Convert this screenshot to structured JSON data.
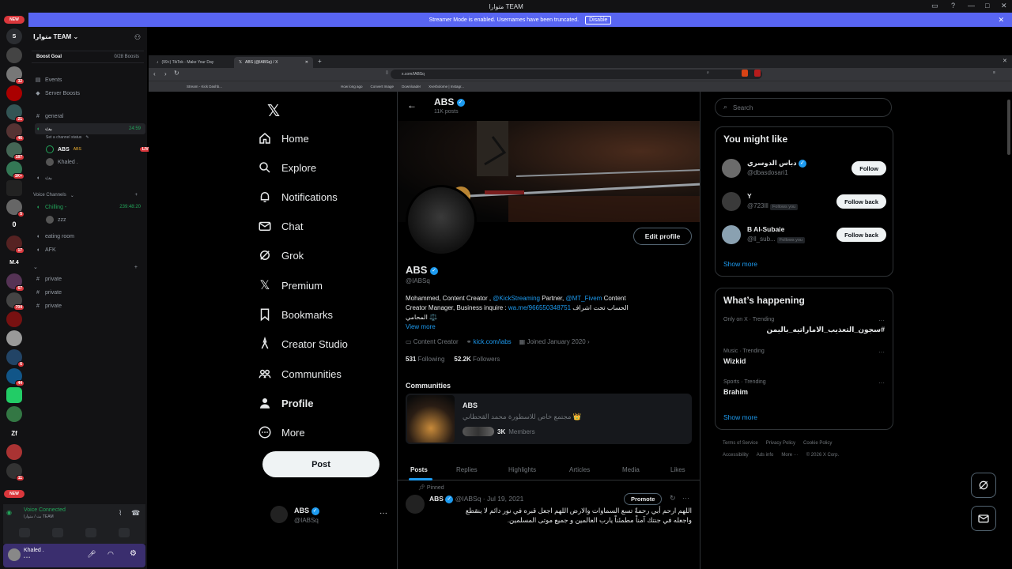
{
  "window": {
    "title": "متوارا TEAM"
  },
  "streamer_banner": {
    "text": "Streamer Mode is enabled. Usernames have been truncated.",
    "button": "Disable"
  },
  "rail": {
    "new_label": "NEW",
    "letter_s": "S",
    "badges": [
      "32",
      "21",
      "46",
      "187",
      "1K+",
      "5",
      "17",
      "67",
      "704",
      "6",
      "44",
      "11"
    ],
    "zero": "0",
    "m4": "M.4",
    "zf": "Zf",
    "new_label_bottom": "NEW"
  },
  "discord": {
    "server_name": "متوارا TEAM",
    "boost_goal": "Boost Goal",
    "boost_count": "0/28 Boosts",
    "events": "Events",
    "server_boosts": "Server Boosts",
    "ch_general": "general",
    "ch_live": "بث",
    "ch_live_time": "24:59",
    "ch_status": "Set a channel status",
    "user_abs": "ABS",
    "user_abs_tag": "ABS",
    "live_badge": "LIVE",
    "user_khaled": "Khaled .",
    "ch_voice2": "بث",
    "voice_channels": "Voice Channels",
    "ch_chilling": "Chilling -",
    "ch_chilling_time": "239:48:20",
    "user_zzz": "zzz",
    "ch_eating": "eating room",
    "ch_afk": "AFK",
    "ch_private": [
      "private",
      "private",
      "private"
    ],
    "voice_connected": "Voice Connected",
    "voice_sub": "بث / متوارا TEAM",
    "me_name": "Khaled .",
    "me_status": "• • •"
  },
  "browser": {
    "tabs": [
      {
        "label": "(99+) TikTok - Make Your Day"
      },
      {
        "label": "ABS (@IABSq) / X"
      }
    ],
    "url": "x.com/IABSq",
    "bookmarks": [
      "Stream - Kick Dashb...",
      "How long ago",
      "Convert Image",
      "Downloader",
      "Xverbolome | Instagr..."
    ]
  },
  "x": {
    "nav": [
      "Home",
      "Explore",
      "Notifications",
      "Chat",
      "Grok",
      "Premium",
      "Bookmarks",
      "Creator Studio",
      "Communities",
      "Profile",
      "More"
    ],
    "post_button": "Post",
    "account_name": "ABS",
    "account_handle": "@IABSq",
    "header_name": "ABS",
    "header_posts": "11K posts",
    "edit_profile": "Edit profile",
    "profile_name": "ABS",
    "profile_handle": "@IABSq",
    "bio_1a": "Mohammed, Content Creator , ",
    "bio_link1": "@KickStreaming",
    "bio_1b": " Partner, ",
    "bio_link2": "@MT_Fivem",
    "bio_1c": " Content",
    "bio_2a": "Creator Manager, Business inquire : ",
    "bio_link3": "wa.me/966550348751",
    "bio_2b": " الحساب تحت اشراف",
    "bio_3": "المحامي ⚖️",
    "view_more": "View more",
    "category": "Content Creator",
    "website": "kick.com/iabs",
    "joined": "Joined January 2020",
    "following_count": "531",
    "following_label": "Following",
    "followers_count": "52.2K",
    "followers_label": "Followers",
    "communities_heading": "Communities",
    "community_name": "ABS",
    "community_desc": "مجتمع خاص للاسطورة محمد القحطاني 👑",
    "community_members_count": "3K",
    "community_members_label": "Members",
    "profile_tabs": [
      "Posts",
      "Replies",
      "Highlights",
      "Articles",
      "Media",
      "Likes"
    ],
    "pinned_label": "Pinned",
    "tweet_name": "ABS",
    "tweet_meta": "@IABSq · Jul 19, 2021",
    "promote": "Promote",
    "tweet_line1": "اللهم ارحم أبي رحمةً تسع السماوات والارض اللهم اجعل قبره في نور دائم لا ينقطع",
    "tweet_line2": "واجعله في جنتك آمناً مطمئناً يارب العالمين و جميع موتى المسلمين."
  },
  "sidebar": {
    "search_placeholder": "Search",
    "you_might_like": "You might like",
    "suggestions": [
      {
        "name": "دباس الدوسري",
        "handle": "@dbasdosari1",
        "tag": "",
        "button": "Follow"
      },
      {
        "name": "Y",
        "handle": "@723lll",
        "tag": "Follows you",
        "button": "Follow back"
      },
      {
        "name": "B Al-Subaie",
        "handle": "@ll_sub...",
        "tag": "Follows you",
        "button": "Follow back"
      }
    ],
    "show_more": "Show more",
    "whats_happening": "What’s happening",
    "trends": [
      {
        "context": "Only on X · Trending",
        "topic": "#سجون_التعذيب_الاماراتيه_باليمن"
      },
      {
        "context": "Music · Trending",
        "topic": "Wizkid"
      },
      {
        "context": "Sports · Trending",
        "topic": "Brahim"
      }
    ],
    "show_more_2": "Show more",
    "footer_1": [
      "Terms of Service",
      "Privacy Policy",
      "Cookie Policy"
    ],
    "footer_2": [
      "Accessibility",
      "Ads info",
      "More ···",
      "© 2026 X Corp."
    ]
  },
  "colors": {
    "accent": "#1d9bf0",
    "discord_blurple": "#5865f2",
    "live_red": "#da373c",
    "voice_green": "#23a55a"
  }
}
